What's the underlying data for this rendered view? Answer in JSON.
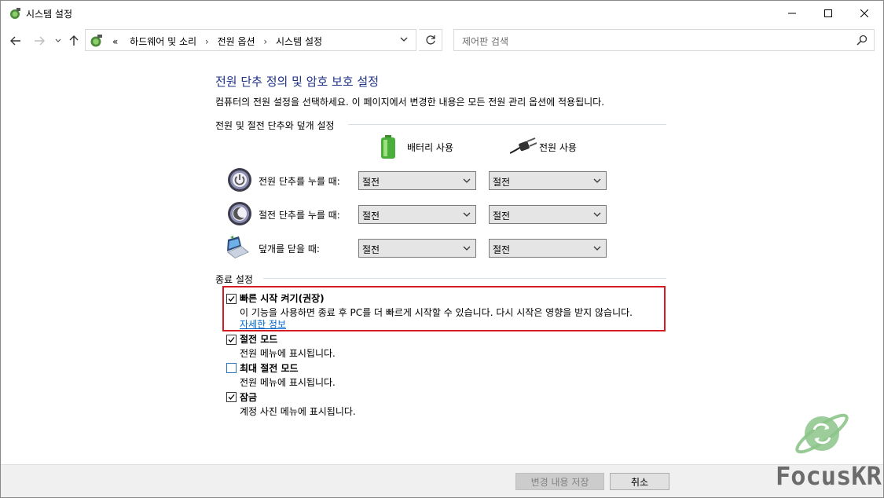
{
  "window": {
    "title": "시스템 설정"
  },
  "address": {
    "prefix": "«",
    "crumbs": [
      "하드웨어 및 소리",
      "전원 옵션",
      "시스템 설정"
    ],
    "search_placeholder": "제어판 검색"
  },
  "page": {
    "heading": "전원 단추 정의 및 암호 보호 설정",
    "description": "컴퓨터의 전원 설정을 선택하세요. 이 페이지에서 변경한 내용은 모든 전원 관리 옵션에 적용됩니다.",
    "power_section_title": "전원 및 절전 단추와 덮개 설정",
    "col_battery": "배터리 사용",
    "col_plugged": "전원 사용",
    "rows": [
      {
        "label": "전원 단추를 누를 때:",
        "battery": "절전",
        "plugged": "절전",
        "icon": "power-button-icon"
      },
      {
        "label": "절전 단추를 누를 때:",
        "battery": "절전",
        "plugged": "절전",
        "icon": "sleep-button-icon"
      },
      {
        "label": "덮개를 닫을 때:",
        "battery": "절전",
        "plugged": "절전",
        "icon": "laptop-lid-icon"
      }
    ],
    "shutdown_section_title": "종료 설정",
    "options": [
      {
        "label": "빠른 시작 켜기(권장)",
        "desc": "이 기능을 사용하면 종료 후 PC를 더 빠르게 시작할 수 있습니다. 다시 시작은 영향을 받지 않습니다.",
        "link": "자세한 정보",
        "checked": true
      },
      {
        "label": "절전 모드",
        "desc": "전원 메뉴에 표시됩니다.",
        "checked": true
      },
      {
        "label": "최대 절전 모드",
        "desc": "전원 메뉴에 표시됩니다.",
        "checked": false
      },
      {
        "label": "잠금",
        "desc": "계정 사진 메뉴에 표시됩니다.",
        "checked": true
      }
    ]
  },
  "footer": {
    "save": "변경 내용 저장",
    "cancel": "취소"
  },
  "watermark": {
    "text": "FocusKR"
  }
}
